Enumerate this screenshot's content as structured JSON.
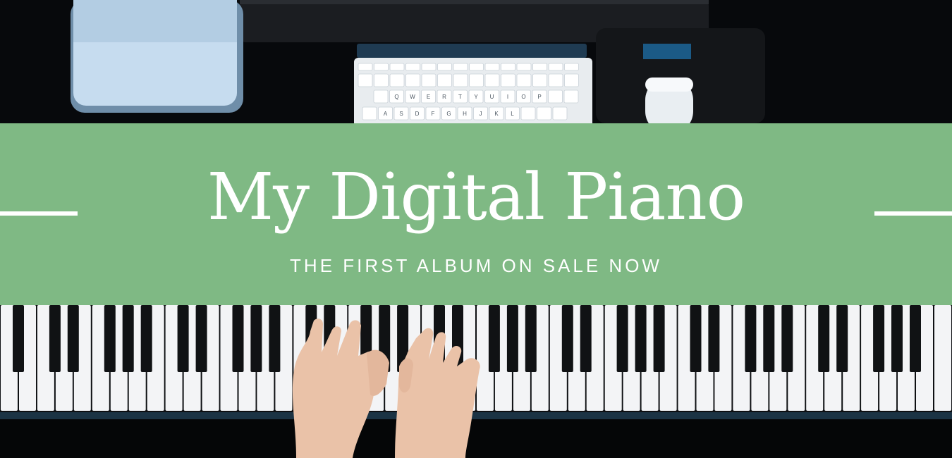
{
  "banner": {
    "title": "My Digital Piano",
    "subtitle": "THE FIRST ALBUM ON SALE NOW",
    "background_color": "#7fb984",
    "text_color": "#ffffff"
  },
  "photo": {
    "keyboard_key_labels": [
      "Q",
      "W",
      "E",
      "R",
      "T",
      "Y",
      "U",
      "I",
      "O",
      "P",
      "A",
      "S",
      "D",
      "F",
      "G",
      "H",
      "J",
      "K",
      "L"
    ]
  }
}
